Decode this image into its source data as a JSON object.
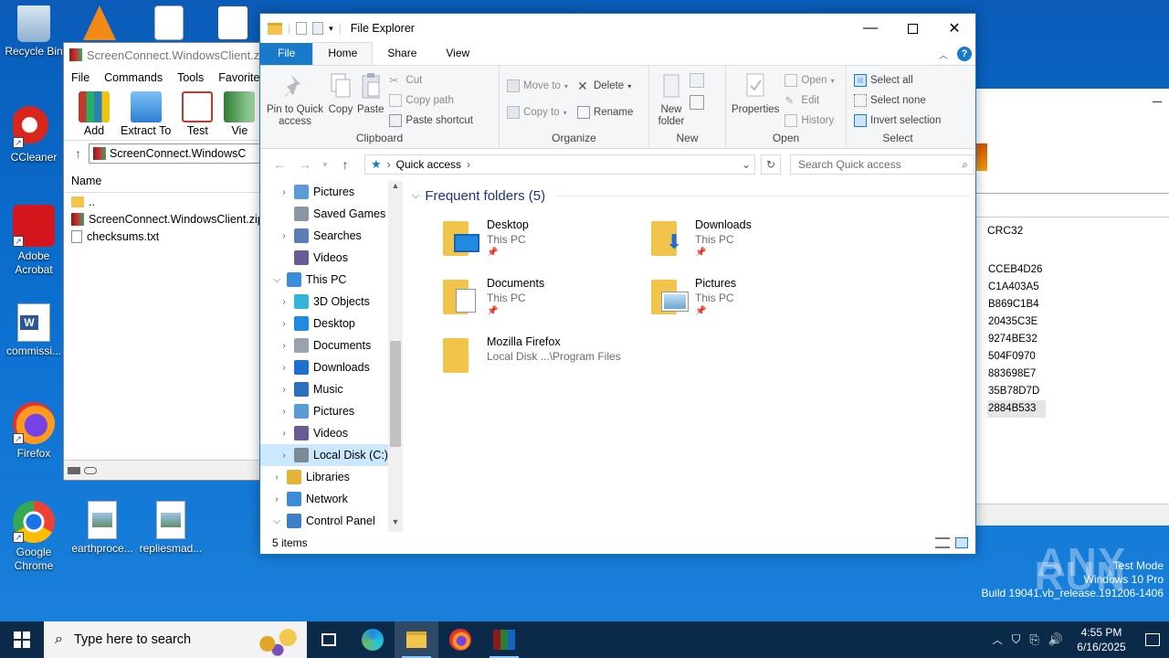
{
  "desktop": {
    "icons": [
      {
        "label": "Recycle Bin"
      },
      {
        "label": "CCleaner"
      },
      {
        "label": "Adobe Acrobat"
      },
      {
        "label": "commissi..."
      },
      {
        "label": "Firefox"
      },
      {
        "label": "Google Chrome"
      },
      {
        "label": "earthproce..."
      },
      {
        "label": "repliesmad..."
      }
    ]
  },
  "winrar": {
    "title": "ScreenConnect.WindowsClient.zip",
    "menu": [
      "File",
      "Commands",
      "Tools",
      "Favorites"
    ],
    "tools": [
      "Add",
      "Extract To",
      "Test",
      "Vie"
    ],
    "path": "ScreenConnect.WindowsC",
    "column_name": "Name",
    "rows": [
      "..",
      "ScreenConnect.WindowsClient.zip",
      "checksums.txt"
    ]
  },
  "crc_window": {
    "column": "CRC32",
    "values": [
      "CCEB4D26",
      "C1A403A5",
      "B869C1B4",
      "20435C3E",
      "9274BE32",
      "504F0970",
      "883698E7",
      "35B78D7D",
      "2884B533"
    ]
  },
  "explorer": {
    "title": "File Explorer",
    "tabs": {
      "file": "File",
      "home": "Home",
      "share": "Share",
      "view": "View"
    },
    "ribbon": {
      "clipboard": {
        "label": "Clipboard",
        "pin": "Pin to Quick access",
        "copy": "Copy",
        "paste": "Paste",
        "cut": "Cut",
        "copy_path": "Copy path",
        "paste_shortcut": "Paste shortcut"
      },
      "organize": {
        "label": "Organize",
        "move_to": "Move to",
        "copy_to": "Copy to",
        "delete": "Delete",
        "rename": "Rename"
      },
      "new": {
        "label": "New",
        "new_folder": "New folder"
      },
      "open": {
        "label": "Open",
        "properties": "Properties",
        "open": "Open",
        "edit": "Edit",
        "history": "History"
      },
      "select": {
        "label": "Select",
        "select_all": "Select all",
        "select_none": "Select none",
        "invert": "Invert selection"
      }
    },
    "address": "Quick access",
    "search_placeholder": "Search Quick access",
    "tree": [
      {
        "label": "Pictures",
        "twisty": ">",
        "indent": 1
      },
      {
        "label": "Saved Games",
        "twisty": "",
        "indent": 1
      },
      {
        "label": "Searches",
        "twisty": ">",
        "indent": 1
      },
      {
        "label": "Videos",
        "twisty": "",
        "indent": 1
      },
      {
        "label": "This PC",
        "twisty": "v",
        "indent": 0
      },
      {
        "label": "3D Objects",
        "twisty": ">",
        "indent": 1
      },
      {
        "label": "Desktop",
        "twisty": ">",
        "indent": 1
      },
      {
        "label": "Documents",
        "twisty": ">",
        "indent": 1
      },
      {
        "label": "Downloads",
        "twisty": ">",
        "indent": 1
      },
      {
        "label": "Music",
        "twisty": ">",
        "indent": 1
      },
      {
        "label": "Pictures",
        "twisty": ">",
        "indent": 1
      },
      {
        "label": "Videos",
        "twisty": ">",
        "indent": 1
      },
      {
        "label": "Local Disk (C:)",
        "twisty": ">",
        "indent": 1
      },
      {
        "label": "Libraries",
        "twisty": ">",
        "indent": 0
      },
      {
        "label": "Network",
        "twisty": ">",
        "indent": 0
      },
      {
        "label": "Control Panel",
        "twisty": "v",
        "indent": 0
      }
    ],
    "section_title": "Frequent folders (5)",
    "folders": [
      {
        "name": "Desktop",
        "location": "This PC",
        "pinned": true
      },
      {
        "name": "Downloads",
        "location": "This PC",
        "pinned": true
      },
      {
        "name": "Documents",
        "location": "This PC",
        "pinned": true
      },
      {
        "name": "Pictures",
        "location": "This PC",
        "pinned": true
      },
      {
        "name": "Mozilla Firefox",
        "location": "Local Disk ...\\Program Files",
        "pinned": false
      }
    ],
    "status": "5 items"
  },
  "watermark": {
    "logo": "ANY RUN",
    "line1": "Test Mode",
    "line2": "Windows 10 Pro",
    "line3": "Build 19041.vb_release.191206-1406"
  },
  "taskbar": {
    "search_placeholder": "Type here to search",
    "time": "4:55 PM",
    "date": "6/16/2025"
  },
  "colors": {
    "accent": "#1979ca",
    "desktop": "#0b6fd0",
    "taskbar": "#0b2a4a",
    "selection": "#cce8ff",
    "folder": "#f3c44a"
  }
}
